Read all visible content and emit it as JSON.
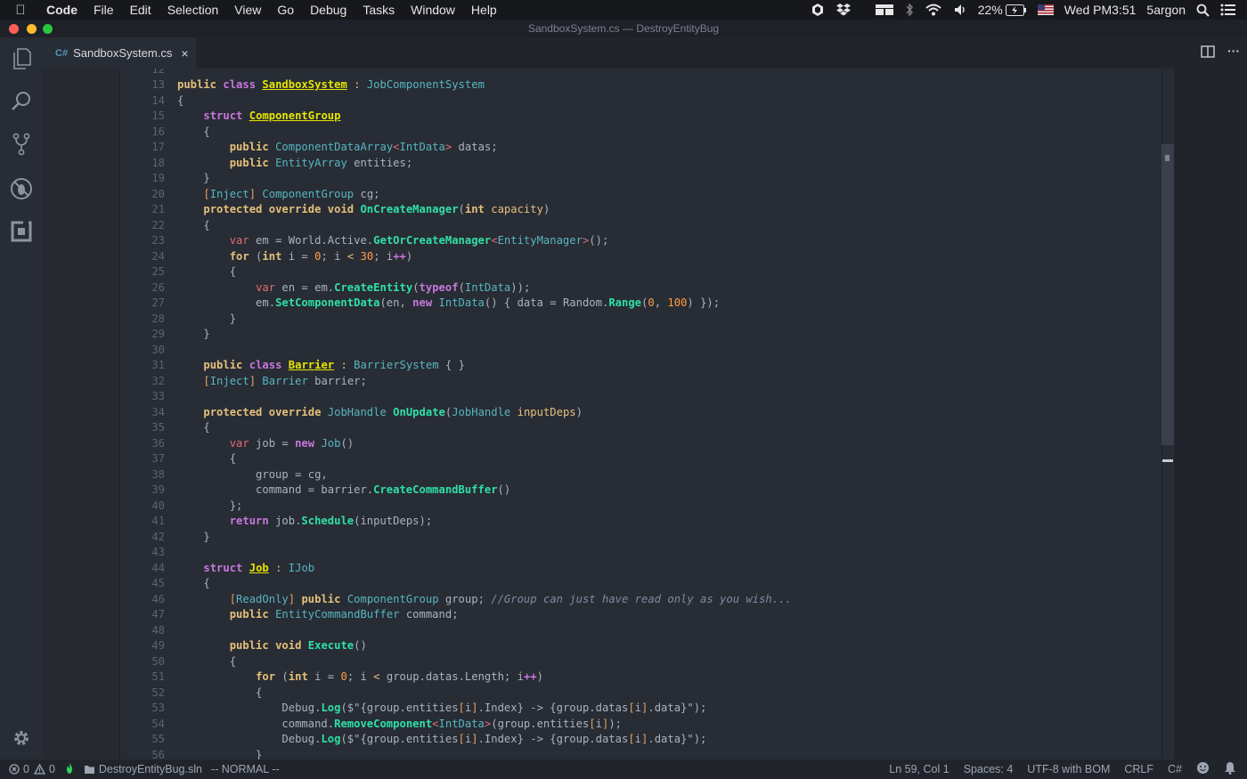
{
  "menubar": {
    "apple": "",
    "app_name": "Code",
    "items": [
      "File",
      "Edit",
      "Selection",
      "View",
      "Go",
      "Debug",
      "Tasks",
      "Window",
      "Help"
    ],
    "battery": "22%",
    "clock": "Wed PM3:51",
    "user": "5argon"
  },
  "window": {
    "title": "SandboxSystem.cs — DestroyEntityBug"
  },
  "tab": {
    "icon_text": "C#",
    "label": "SandboxSystem.cs",
    "close": "×"
  },
  "tab_actions": {
    "more": "···"
  },
  "code_lines": [
    {
      "n": "12",
      "t": []
    },
    {
      "n": "13",
      "t": [
        [
          "pub",
          "public"
        ],
        [
          "pn",
          " "
        ],
        [
          "kw",
          "class"
        ],
        [
          "pn",
          " "
        ],
        [
          "cn",
          "SandboxSystem"
        ],
        [
          "pn",
          " "
        ],
        [
          "op",
          ":"
        ],
        [
          "pn",
          " "
        ],
        [
          "ty",
          "JobComponentSystem"
        ]
      ]
    },
    {
      "n": "14",
      "t": [
        [
          "pn",
          "{"
        ]
      ]
    },
    {
      "n": "15",
      "t": [
        [
          "pn",
          "    "
        ],
        [
          "kw",
          "struct"
        ],
        [
          "pn",
          " "
        ],
        [
          "cn",
          "ComponentGroup"
        ]
      ]
    },
    {
      "n": "16",
      "t": [
        [
          "pn",
          "    {"
        ]
      ]
    },
    {
      "n": "17",
      "t": [
        [
          "pn",
          "        "
        ],
        [
          "pub",
          "public"
        ],
        [
          "pn",
          " "
        ],
        [
          "ty",
          "ComponentDataArray"
        ],
        [
          "vr",
          "<"
        ],
        [
          "ty",
          "IntData"
        ],
        [
          "vr",
          ">"
        ],
        [
          "pn",
          " datas;"
        ]
      ]
    },
    {
      "n": "18",
      "t": [
        [
          "pn",
          "        "
        ],
        [
          "pub",
          "public"
        ],
        [
          "pn",
          " "
        ],
        [
          "ty",
          "EntityArray"
        ],
        [
          "pn",
          " entities;"
        ]
      ]
    },
    {
      "n": "19",
      "t": [
        [
          "pn",
          "    }"
        ]
      ]
    },
    {
      "n": "20",
      "t": [
        [
          "pn",
          "    "
        ],
        [
          "ib",
          "["
        ],
        [
          "ty",
          "Inject"
        ],
        [
          "ib",
          "]"
        ],
        [
          "pn",
          " "
        ],
        [
          "ty",
          "ComponentGroup"
        ],
        [
          "pn",
          " cg;"
        ]
      ]
    },
    {
      "n": "21",
      "t": [
        [
          "pn",
          "    "
        ],
        [
          "pub",
          "protected override void"
        ],
        [
          "pn",
          " "
        ],
        [
          "fn",
          "OnCreateManager"
        ],
        [
          "pn",
          "("
        ],
        [
          "pub",
          "int"
        ],
        [
          "pn",
          " "
        ],
        [
          "prm",
          "capacity"
        ],
        [
          "pn",
          ")"
        ]
      ]
    },
    {
      "n": "22",
      "t": [
        [
          "pn",
          "    {"
        ]
      ]
    },
    {
      "n": "23",
      "t": [
        [
          "pn",
          "        "
        ],
        [
          "vr",
          "var"
        ],
        [
          "pn",
          " em = World.Active."
        ],
        [
          "fn",
          "GetOrCreateManager"
        ],
        [
          "vr",
          "<"
        ],
        [
          "ty",
          "EntityManager"
        ],
        [
          "vr",
          ">"
        ],
        [
          "pn",
          "();"
        ]
      ]
    },
    {
      "n": "24",
      "t": [
        [
          "pn",
          "        "
        ],
        [
          "pub",
          "for"
        ],
        [
          "pn",
          " ("
        ],
        [
          "pub",
          "int"
        ],
        [
          "pn",
          " i = "
        ],
        [
          "nm",
          "0"
        ],
        [
          "pn",
          "; i "
        ],
        [
          "op",
          "<"
        ],
        [
          "pn",
          " "
        ],
        [
          "nm",
          "30"
        ],
        [
          "pn",
          "; i"
        ],
        [
          "kw",
          "++"
        ],
        [
          "pn",
          ")"
        ]
      ]
    },
    {
      "n": "25",
      "t": [
        [
          "pn",
          "        {"
        ]
      ]
    },
    {
      "n": "26",
      "t": [
        [
          "pn",
          "            "
        ],
        [
          "vr",
          "var"
        ],
        [
          "pn",
          " en = em."
        ],
        [
          "fn",
          "CreateEntity"
        ],
        [
          "pn",
          "("
        ],
        [
          "kw",
          "typeof"
        ],
        [
          "pn",
          "("
        ],
        [
          "ty",
          "IntData"
        ],
        [
          "pn",
          "));"
        ]
      ]
    },
    {
      "n": "27",
      "t": [
        [
          "pn",
          "            em."
        ],
        [
          "fn",
          "SetComponentData"
        ],
        [
          "pn",
          "(en, "
        ],
        [
          "kw",
          "new"
        ],
        [
          "pn",
          " "
        ],
        [
          "ty",
          "IntData"
        ],
        [
          "pn",
          "() { data = Random."
        ],
        [
          "fn",
          "Range"
        ],
        [
          "pn",
          "("
        ],
        [
          "nm",
          "0"
        ],
        [
          "pn",
          ", "
        ],
        [
          "nm",
          "100"
        ],
        [
          "pn",
          ") });"
        ]
      ]
    },
    {
      "n": "28",
      "t": [
        [
          "pn",
          "        }"
        ]
      ]
    },
    {
      "n": "29",
      "t": [
        [
          "pn",
          "    }"
        ]
      ]
    },
    {
      "n": "30",
      "t": []
    },
    {
      "n": "31",
      "t": [
        [
          "pn",
          "    "
        ],
        [
          "pub",
          "public"
        ],
        [
          "pn",
          " "
        ],
        [
          "kw",
          "class"
        ],
        [
          "pn",
          " "
        ],
        [
          "cn",
          "Barrier"
        ],
        [
          "pn",
          " "
        ],
        [
          "op",
          ":"
        ],
        [
          "pn",
          " "
        ],
        [
          "ty",
          "BarrierSystem"
        ],
        [
          "pn",
          " { }"
        ]
      ]
    },
    {
      "n": "32",
      "t": [
        [
          "pn",
          "    "
        ],
        [
          "ib",
          "["
        ],
        [
          "ty",
          "Inject"
        ],
        [
          "ib",
          "]"
        ],
        [
          "pn",
          " "
        ],
        [
          "ty",
          "Barrier"
        ],
        [
          "pn",
          " barrier;"
        ]
      ]
    },
    {
      "n": "33",
      "t": []
    },
    {
      "n": "34",
      "t": [
        [
          "pn",
          "    "
        ],
        [
          "pub",
          "protected override"
        ],
        [
          "pn",
          " "
        ],
        [
          "ty",
          "JobHandle"
        ],
        [
          "pn",
          " "
        ],
        [
          "fn",
          "OnUpdate"
        ],
        [
          "pn",
          "("
        ],
        [
          "ty",
          "JobHandle"
        ],
        [
          "pn",
          " "
        ],
        [
          "prm",
          "inputDeps"
        ],
        [
          "pn",
          ")"
        ]
      ]
    },
    {
      "n": "35",
      "t": [
        [
          "pn",
          "    {"
        ]
      ]
    },
    {
      "n": "36",
      "t": [
        [
          "pn",
          "        "
        ],
        [
          "vr",
          "var"
        ],
        [
          "pn",
          " job = "
        ],
        [
          "kw",
          "new"
        ],
        [
          "pn",
          " "
        ],
        [
          "ty",
          "Job"
        ],
        [
          "pn",
          "()"
        ]
      ]
    },
    {
      "n": "37",
      "t": [
        [
          "pn",
          "        {"
        ]
      ]
    },
    {
      "n": "38",
      "t": [
        [
          "pn",
          "            group = cg,"
        ]
      ]
    },
    {
      "n": "39",
      "t": [
        [
          "pn",
          "            command = barrier."
        ],
        [
          "fn",
          "CreateCommandBuffer"
        ],
        [
          "pn",
          "()"
        ]
      ]
    },
    {
      "n": "40",
      "t": [
        [
          "pn",
          "        };"
        ]
      ]
    },
    {
      "n": "41",
      "t": [
        [
          "pn",
          "        "
        ],
        [
          "kw",
          "return"
        ],
        [
          "pn",
          " job."
        ],
        [
          "fn",
          "Schedule"
        ],
        [
          "pn",
          "(inputDeps);"
        ]
      ]
    },
    {
      "n": "42",
      "t": [
        [
          "pn",
          "    }"
        ]
      ]
    },
    {
      "n": "43",
      "t": []
    },
    {
      "n": "44",
      "t": [
        [
          "pn",
          "    "
        ],
        [
          "kw",
          "struct"
        ],
        [
          "pn",
          " "
        ],
        [
          "cn",
          "Job"
        ],
        [
          "pn",
          " "
        ],
        [
          "op",
          ":"
        ],
        [
          "pn",
          " "
        ],
        [
          "ty",
          "IJob"
        ]
      ]
    },
    {
      "n": "45",
      "t": [
        [
          "pn",
          "    {"
        ]
      ]
    },
    {
      "n": "46",
      "t": [
        [
          "pn",
          "        "
        ],
        [
          "ib",
          "["
        ],
        [
          "ty",
          "ReadOnly"
        ],
        [
          "ib",
          "]"
        ],
        [
          "pn",
          " "
        ],
        [
          "pub",
          "public"
        ],
        [
          "pn",
          " "
        ],
        [
          "ty",
          "ComponentGroup"
        ],
        [
          "pn",
          " group; "
        ],
        [
          "cm",
          "//Group can just have read only as you wish..."
        ]
      ]
    },
    {
      "n": "47",
      "t": [
        [
          "pn",
          "        "
        ],
        [
          "pub",
          "public"
        ],
        [
          "pn",
          " "
        ],
        [
          "ty",
          "EntityCommandBuffer"
        ],
        [
          "pn",
          " command;"
        ]
      ]
    },
    {
      "n": "48",
      "t": []
    },
    {
      "n": "49",
      "t": [
        [
          "pn",
          "        "
        ],
        [
          "pub",
          "public void"
        ],
        [
          "pn",
          " "
        ],
        [
          "fn",
          "Execute"
        ],
        [
          "pn",
          "()"
        ]
      ]
    },
    {
      "n": "50",
      "t": [
        [
          "pn",
          "        {"
        ]
      ]
    },
    {
      "n": "51",
      "t": [
        [
          "pn",
          "            "
        ],
        [
          "pub",
          "for"
        ],
        [
          "pn",
          " ("
        ],
        [
          "pub",
          "int"
        ],
        [
          "pn",
          " i = "
        ],
        [
          "nm",
          "0"
        ],
        [
          "pn",
          "; i "
        ],
        [
          "op",
          "<"
        ],
        [
          "pn",
          " group.datas.Length; i"
        ],
        [
          "kw",
          "++"
        ],
        [
          "pn",
          ")"
        ]
      ]
    },
    {
      "n": "52",
      "t": [
        [
          "pn",
          "            {"
        ]
      ]
    },
    {
      "n": "53",
      "t": [
        [
          "pn",
          "                Debug."
        ],
        [
          "fn",
          "Log"
        ],
        [
          "pn",
          "($\"{group.entities"
        ],
        [
          "ib",
          "["
        ],
        [
          "pn",
          "i"
        ],
        [
          "ib",
          "]"
        ],
        [
          "pn",
          ".Index} -> {group.datas"
        ],
        [
          "ib",
          "["
        ],
        [
          "pn",
          "i"
        ],
        [
          "ib",
          "]"
        ],
        [
          "pn",
          ".data}\");"
        ]
      ]
    },
    {
      "n": "54",
      "t": [
        [
          "pn",
          "                command."
        ],
        [
          "fn",
          "RemoveComponent"
        ],
        [
          "vr",
          "<"
        ],
        [
          "ty",
          "IntData"
        ],
        [
          "vr",
          ">"
        ],
        [
          "pn",
          "(group.entities"
        ],
        [
          "ib",
          "["
        ],
        [
          "pn",
          "i"
        ],
        [
          "ib",
          "]"
        ],
        [
          "pn",
          ");"
        ]
      ]
    },
    {
      "n": "55",
      "t": [
        [
          "pn",
          "                Debug."
        ],
        [
          "fn",
          "Log"
        ],
        [
          "pn",
          "($\"{group.entities"
        ],
        [
          "ib",
          "["
        ],
        [
          "pn",
          "i"
        ],
        [
          "ib",
          "]"
        ],
        [
          "pn",
          ".Index} -> {group.datas"
        ],
        [
          "ib",
          "["
        ],
        [
          "pn",
          "i"
        ],
        [
          "ib",
          "]"
        ],
        [
          "pn",
          ".data}\");"
        ]
      ]
    },
    {
      "n": "56",
      "t": [
        [
          "pn",
          "            }"
        ]
      ]
    }
  ],
  "statusbar": {
    "errors": "0",
    "warnings": "0",
    "solution": "DestroyEntityBug.sln",
    "mode": "-- NORMAL --",
    "position": "Ln 59, Col 1",
    "spaces": "Spaces: 4",
    "encoding": "UTF-8 with BOM",
    "eol": "CRLF",
    "language": "C#"
  },
  "colors": {
    "close": "#ff5f57",
    "minimize": "#febc2e",
    "maximize": "#28c840",
    "editor_bg": "#282c34",
    "accent": "#2fe0a6"
  }
}
